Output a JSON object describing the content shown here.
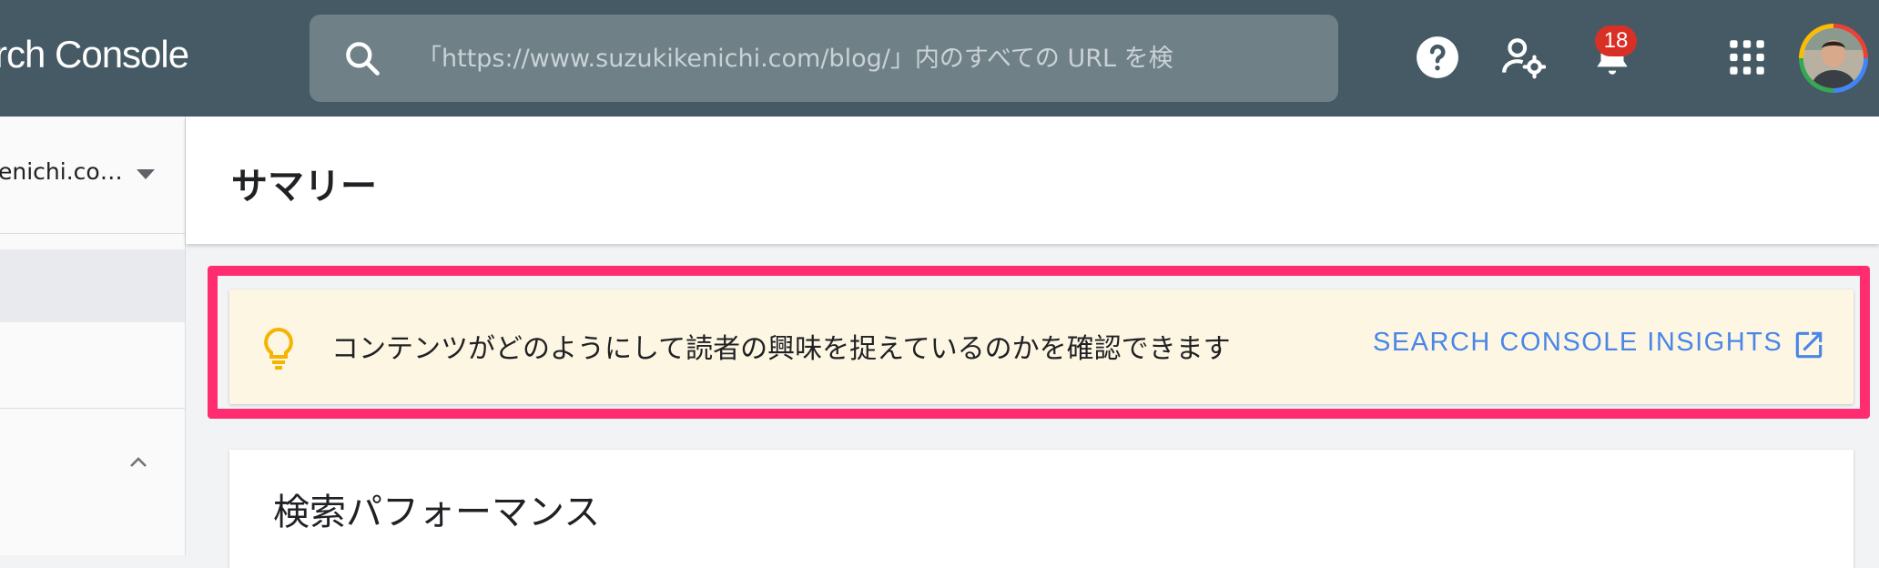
{
  "header": {
    "brand_text": "rch Console",
    "search_placeholder": "「https://www.suzukikenichi.com/blog/」内のすべての URL を検",
    "notification_count": "18"
  },
  "icons": {
    "search": "search-icon",
    "help": "help-icon",
    "user_settings": "user-settings-icon",
    "notifications": "bell-icon",
    "apps": "apps-grid-icon",
    "lightbulb": "lightbulb-icon",
    "open_external": "open-in-new-icon",
    "collapse": "chevron-up-icon",
    "dropdown": "caret-down-icon"
  },
  "sidebar": {
    "property_label": "enichi.co…"
  },
  "main": {
    "page_title": "サマリー",
    "insight": {
      "text": "コンテンツがどのようにして読者の興味を捉えているのかを確認できます",
      "link_label": "SEARCH CONSOLE INSIGHTS"
    },
    "performance": {
      "title": "検索パフォーマンス"
    }
  },
  "colors": {
    "header_bg": "#455a64",
    "highlight_border": "#ff2d6f",
    "insight_bg": "#fdf6e3",
    "link": "#4a86e8",
    "badge": "#d93025",
    "bulb": "#f4b400"
  }
}
